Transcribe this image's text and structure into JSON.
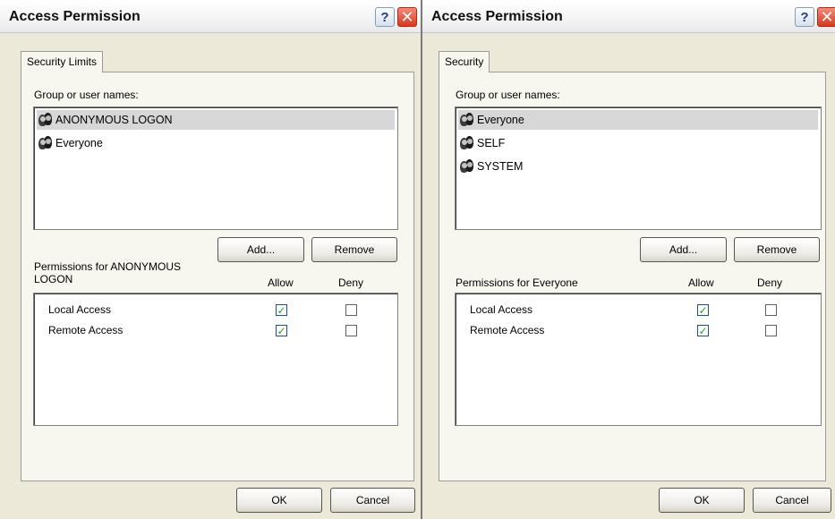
{
  "left": {
    "title": "Access Permission",
    "tab": "Security Limits",
    "group_label": "Group or user names:",
    "users": [
      {
        "name": "ANONYMOUS LOGON",
        "selected": true
      },
      {
        "name": "Everyone",
        "selected": false
      }
    ],
    "add_button": "Add...",
    "remove_button": "Remove",
    "perm_label_line1": "Permissions for ANONYMOUS",
    "perm_label_line2": "LOGON",
    "allow_header": "Allow",
    "deny_header": "Deny",
    "permissions": [
      {
        "name": "Local Access",
        "allow": true,
        "deny": false
      },
      {
        "name": "Remote Access",
        "allow": true,
        "deny": false
      }
    ],
    "ok_button": "OK",
    "cancel_button": "Cancel"
  },
  "right": {
    "title": "Access Permission",
    "tab": "Security",
    "group_label": "Group or user names:",
    "users": [
      {
        "name": "Everyone",
        "selected": true
      },
      {
        "name": "SELF",
        "selected": false
      },
      {
        "name": "SYSTEM",
        "selected": false
      }
    ],
    "add_button": "Add...",
    "remove_button": "Remove",
    "perm_label_line1": "Permissions for Everyone",
    "allow_header": "Allow",
    "deny_header": "Deny",
    "permissions": [
      {
        "name": "Local Access",
        "allow": true,
        "deny": false
      },
      {
        "name": "Remote Access",
        "allow": true,
        "deny": false
      }
    ],
    "ok_button": "OK",
    "cancel_button": "Cancel"
  },
  "colors": {
    "dialog_bg": "#ece9d8",
    "selection": "#d7d7d7",
    "close_button": "#d9381e",
    "check_mark": "#21a121"
  },
  "icons": {
    "title_help": "help-icon",
    "title_close": "close-icon",
    "user": "user-group-icon",
    "check": "checkmark-icon"
  }
}
